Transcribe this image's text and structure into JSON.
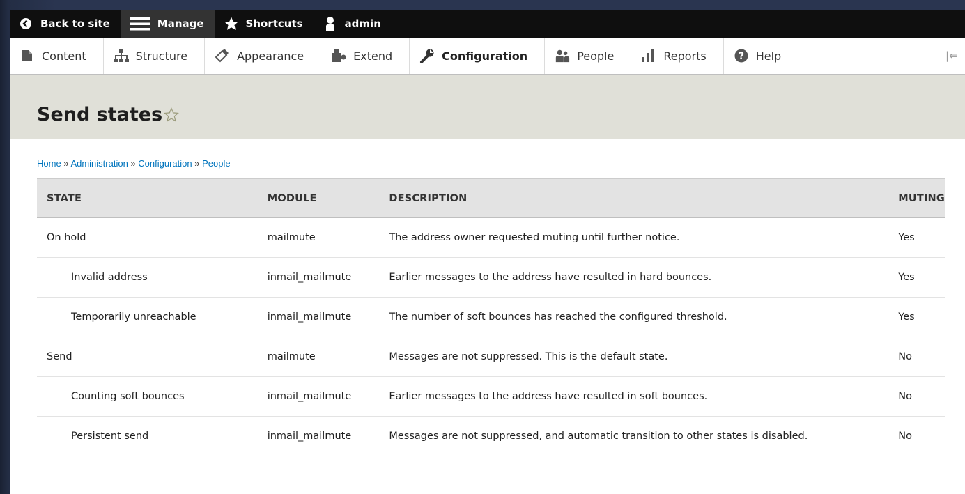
{
  "toolbar": {
    "back": "Back to site",
    "manage": "Manage",
    "shortcuts": "Shortcuts",
    "user": "admin"
  },
  "tray": {
    "items": [
      {
        "label": "Content",
        "icon": "content-icon"
      },
      {
        "label": "Structure",
        "icon": "structure-icon"
      },
      {
        "label": "Appearance",
        "icon": "appearance-icon"
      },
      {
        "label": "Extend",
        "icon": "extend-icon"
      },
      {
        "label": "Configuration",
        "icon": "configuration-icon",
        "active": true
      },
      {
        "label": "People",
        "icon": "people-icon"
      },
      {
        "label": "Reports",
        "icon": "reports-icon"
      },
      {
        "label": "Help",
        "icon": "help-icon"
      }
    ],
    "collapse": "|⇐"
  },
  "page": {
    "title": "Send states"
  },
  "breadcrumb": {
    "items": [
      "Home",
      "Administration",
      "Configuration",
      "People"
    ],
    "separator": "»"
  },
  "table": {
    "headers": [
      "STATE",
      "MODULE",
      "DESCRIPTION",
      "MUTING"
    ],
    "rows": [
      {
        "state": "On hold",
        "module": "mailmute",
        "description": "The address owner requested muting until further notice.",
        "muting": "Yes",
        "indent": false
      },
      {
        "state": "Invalid address",
        "module": "inmail_mailmute",
        "description": "Earlier messages to the address have resulted in hard bounces.",
        "muting": "Yes",
        "indent": true
      },
      {
        "state": "Temporarily unreachable",
        "module": "inmail_mailmute",
        "description": "The number of soft bounces has reached the configured threshold.",
        "muting": "Yes",
        "indent": true
      },
      {
        "state": "Send",
        "module": "mailmute",
        "description": "Messages are not suppressed. This is the default state.",
        "muting": "No",
        "indent": false
      },
      {
        "state": "Counting soft bounces",
        "module": "inmail_mailmute",
        "description": "Earlier messages to the address have resulted in soft bounces.",
        "muting": "No",
        "indent": true
      },
      {
        "state": "Persistent send",
        "module": "inmail_mailmute",
        "description": "Messages are not suppressed, and automatic transition to other states is disabled.",
        "muting": "No",
        "indent": true
      }
    ]
  },
  "colors": {
    "toolbar_bg": "#0f0f0f",
    "header_bg": "#e0e0d8",
    "link": "#0074bd"
  }
}
